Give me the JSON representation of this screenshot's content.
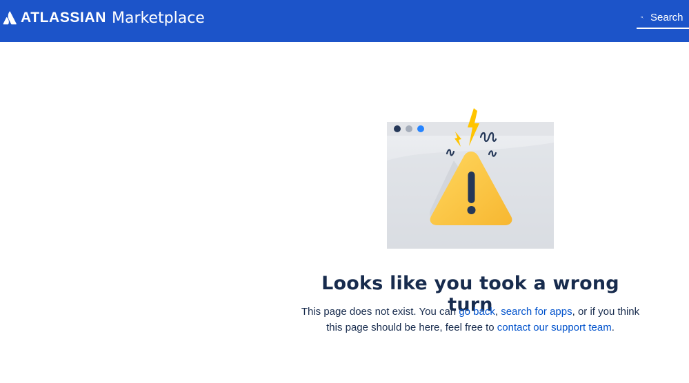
{
  "header": {
    "brand_name": "ATLASSIAN",
    "product_name": "Marketplace",
    "search": {
      "placeholder": "Search"
    }
  },
  "error": {
    "title": "Looks like you took a wrong turn",
    "message": {
      "part1": "This page does not exist. You can ",
      "link_back": "go back",
      "sep1": ", ",
      "link_search": "search for apps",
      "part2": ", or if you think this page should be here, feel free to ",
      "link_support": "contact our support team",
      "end": "."
    }
  },
  "colors": {
    "header_bg": "#1c54c9",
    "link": "#0052cc",
    "text": "#172b4d",
    "warning": "#f9c84a"
  },
  "icons": [
    "atlassian-logo-icon",
    "search-icon",
    "warning-icon",
    "lightning-bolt-icon"
  ]
}
